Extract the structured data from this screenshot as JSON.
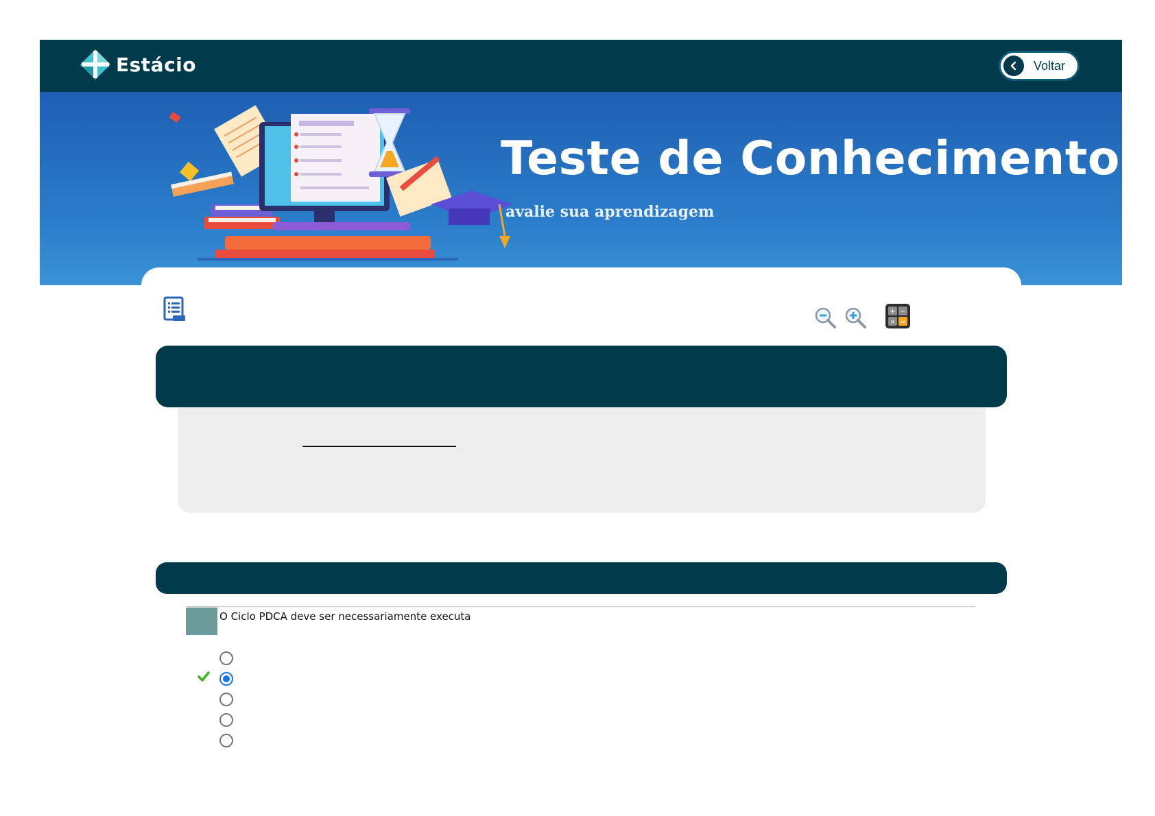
{
  "navbar": {
    "logo_text": "Estácio",
    "back_label": "Voltar"
  },
  "banner": {
    "title": "Teste de Conhecimento",
    "subtitle": "avalie sua aprendizagem"
  },
  "toolbar": {
    "icons": [
      "list-icon",
      "zoom-out-icon",
      "zoom-in-icon",
      "calculator-icon"
    ]
  },
  "question": {
    "statement": "O Ciclo PDCA deve ser necessariamente executa"
  },
  "options": [
    {
      "checked": false,
      "correct": false
    },
    {
      "checked": true,
      "correct": true
    },
    {
      "checked": false,
      "correct": false
    },
    {
      "checked": false,
      "correct": false
    },
    {
      "checked": false,
      "correct": false
    }
  ],
  "colors": {
    "navbar": "#013a4b",
    "banner": "#2a7cc9",
    "marker": "#6c9b9c",
    "radio_selected": "#1a73e8",
    "correct_check": "#3cb521"
  }
}
